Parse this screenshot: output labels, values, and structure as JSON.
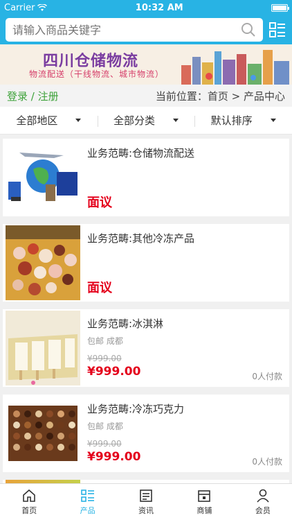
{
  "status": {
    "carrier": "Carrier",
    "time": "10:32 AM"
  },
  "search": {
    "placeholder": "请输入商品关键字"
  },
  "banner": {
    "title": "四川仓储物流",
    "subtitle": "物流配送（干线物流、城市物流）"
  },
  "crumb": {
    "login": "登录 / 注册",
    "position": "当前位置：首页 > 产品中心"
  },
  "filters": [
    {
      "label": "全部地区"
    },
    {
      "label": "全部分类"
    },
    {
      "label": "默认排序"
    }
  ],
  "products": [
    {
      "title": "业务范畴:仓储物流配送",
      "price": "面议"
    },
    {
      "title": "业务范畴:其他冷冻产品",
      "price": "面议"
    },
    {
      "title": "业务范畴:冰淇淋",
      "meta": "包邮 成都",
      "old_price": "¥999.00",
      "price": "¥999.00",
      "paid": "0人付款"
    },
    {
      "title": "业务范畴:冷冻巧克力",
      "meta": "包邮 成都",
      "old_price": "¥999.00",
      "price": "¥999.00",
      "paid": "0人付款"
    }
  ],
  "tabbar": {
    "items": [
      {
        "label": "首页"
      },
      {
        "label": "产品"
      },
      {
        "label": "资讯"
      },
      {
        "label": "商铺"
      },
      {
        "label": "会员"
      }
    ],
    "active_color": "#28b3e4"
  },
  "colors": {
    "header": "#28b3e4",
    "price": "#e4001b",
    "login": "#3ea23a"
  }
}
